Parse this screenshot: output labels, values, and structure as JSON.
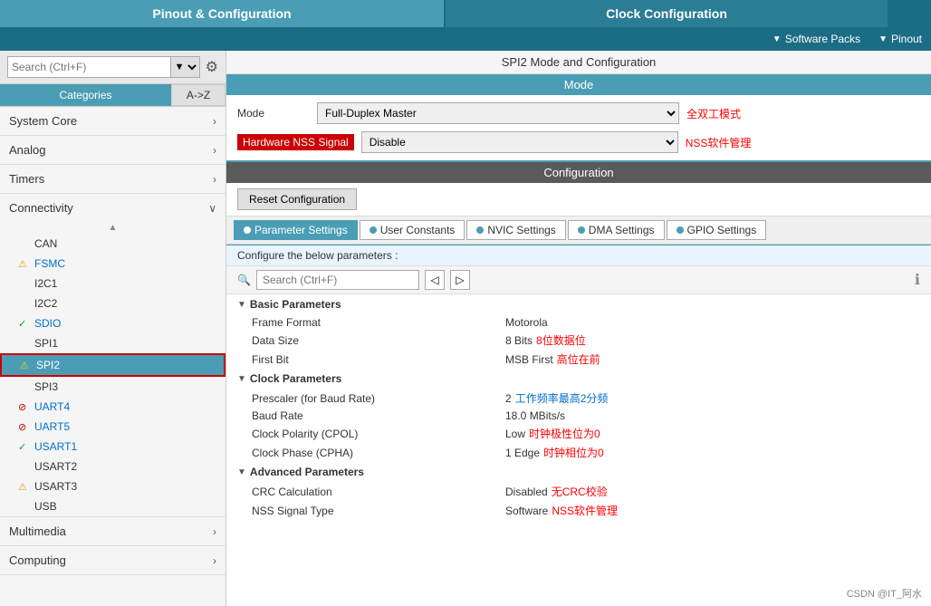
{
  "header": {
    "pinout_label": "Pinout & Configuration",
    "clock_label": "Clock Configuration"
  },
  "subheader": {
    "software_packs": "Software Packs",
    "pinout": "Pinout"
  },
  "sidebar": {
    "search_placeholder": "Search (Ctrl+F)",
    "tab_categories": "Categories",
    "tab_atoz": "A->Z",
    "sections": [
      {
        "id": "system-core",
        "label": "System Core",
        "expanded": false,
        "items": []
      },
      {
        "id": "analog",
        "label": "Analog",
        "expanded": false,
        "items": []
      },
      {
        "id": "timers",
        "label": "Timers",
        "expanded": false,
        "items": []
      },
      {
        "id": "connectivity",
        "label": "Connectivity",
        "expanded": true,
        "items": [
          {
            "id": "can",
            "label": "CAN",
            "icon": ""
          },
          {
            "id": "fsmc",
            "label": "FSMC",
            "icon": "warning"
          },
          {
            "id": "i2c1",
            "label": "I2C1",
            "icon": ""
          },
          {
            "id": "i2c2",
            "label": "I2C2",
            "icon": ""
          },
          {
            "id": "sdio",
            "label": "SDIO",
            "icon": "check"
          },
          {
            "id": "spi1",
            "label": "SPI1",
            "icon": ""
          },
          {
            "id": "spi2",
            "label": "SPI2",
            "icon": "warning",
            "selected": true
          },
          {
            "id": "spi3",
            "label": "SPI3",
            "icon": ""
          },
          {
            "id": "uart4",
            "label": "UART4",
            "icon": "cancel"
          },
          {
            "id": "uart5",
            "label": "UART5",
            "icon": "cancel"
          },
          {
            "id": "usart1",
            "label": "USART1",
            "icon": "check"
          },
          {
            "id": "usart2",
            "label": "USART2",
            "icon": ""
          },
          {
            "id": "usart3",
            "label": "USART3",
            "icon": "warning"
          },
          {
            "id": "usb",
            "label": "USB",
            "icon": ""
          }
        ]
      },
      {
        "id": "multimedia",
        "label": "Multimedia",
        "expanded": false,
        "items": []
      },
      {
        "id": "computing",
        "label": "Computing",
        "expanded": false,
        "items": []
      }
    ]
  },
  "content": {
    "title": "SPI2 Mode and Configuration",
    "mode_section_label": "Mode",
    "mode_label": "Mode",
    "mode_value": "Full-Duplex Master",
    "mode_annotation": "全双工模式",
    "nss_label": "Hardware NSS Signal",
    "nss_value": "Disable",
    "nss_annotation": "NSS软件管理",
    "config_section_label": "Configuration",
    "reset_btn_label": "Reset Configuration",
    "tabs": [
      {
        "id": "parameter-settings",
        "label": "Parameter Settings",
        "active": true
      },
      {
        "id": "user-constants",
        "label": "User Constants",
        "active": false
      },
      {
        "id": "nvic-settings",
        "label": "NVIC Settings",
        "active": false
      },
      {
        "id": "dma-settings",
        "label": "DMA Settings",
        "active": false
      },
      {
        "id": "gpio-settings",
        "label": "GPIO Settings",
        "active": false
      }
    ],
    "param_desc": "Configure the below parameters :",
    "search_placeholder": "Search (Ctrl+F)",
    "groups": [
      {
        "id": "basic-params",
        "label": "Basic Parameters",
        "expanded": true,
        "params": [
          {
            "name": "Frame Format",
            "value": "Motorola",
            "annotation": "",
            "annotation_color": ""
          },
          {
            "name": "Data Size",
            "value": "8 Bits",
            "annotation": "8位数据位",
            "annotation_color": "red"
          },
          {
            "name": "First Bit",
            "value": "MSB First",
            "annotation": "高位在前",
            "annotation_color": "red"
          }
        ]
      },
      {
        "id": "clock-params",
        "label": "Clock Parameters",
        "expanded": true,
        "params": [
          {
            "name": "Prescaler (for Baud Rate)",
            "value": "2",
            "annotation": "工作频率最高2分频",
            "annotation_color": "blue"
          },
          {
            "name": "Baud Rate",
            "value": "18.0 MBits/s",
            "annotation": "",
            "annotation_color": ""
          },
          {
            "name": "Clock Polarity (CPOL)",
            "value": "Low",
            "annotation": "时钟极性位为0",
            "annotation_color": "red"
          },
          {
            "name": "Clock Phase (CPHA)",
            "value": "1 Edge",
            "annotation": "时钟相位为0",
            "annotation_color": "red"
          }
        ]
      },
      {
        "id": "advanced-params",
        "label": "Advanced Parameters",
        "expanded": true,
        "params": [
          {
            "name": "CRC Calculation",
            "value": "Disabled",
            "annotation": "无CRC校验",
            "annotation_color": "red"
          },
          {
            "name": "NSS Signal Type",
            "value": "Software",
            "annotation": "NSS软件管理",
            "annotation_color": "red"
          }
        ]
      }
    ]
  },
  "watermark": "CSDN @IT_阿水"
}
